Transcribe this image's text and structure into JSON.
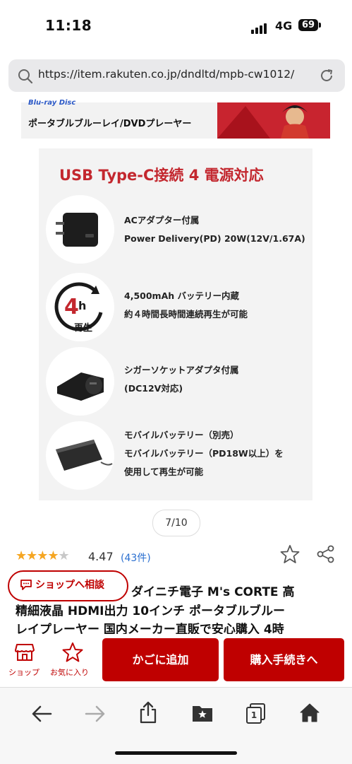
{
  "status_bar": {
    "time": "11:18",
    "network": "4G",
    "battery": "69"
  },
  "browser": {
    "url": "https://item.rakuten.co.jp/dndltd/mpb-cw1012/"
  },
  "banner": {
    "brand": "Blu-ray Disc",
    "text": "ポータブルブルーレイ/DVDプレーヤー"
  },
  "product_image": {
    "heading": "USB Type-C接続 4 電源対応",
    "features": [
      {
        "lines": [
          "ACアダプター付属",
          "Power Delivery(PD) 20W(12V/1.67A)"
        ]
      },
      {
        "icon_text": "4h",
        "icon_label": "再生",
        "lines": [
          "4,500mAh バッテリー内蔵",
          "約４時間長時間連続再生が可能"
        ]
      },
      {
        "lines": [
          "シガーソケットアダプタ付属",
          "(DC12V対応)"
        ]
      },
      {
        "lines": [
          "モバイルバッテリー（別売）",
          "モバイルバッテリー（PD18W以上）を",
          "使用して再生が可能"
        ]
      }
    ]
  },
  "pager": "7/10",
  "rating": {
    "value": "4.47",
    "count": "(43件)",
    "stars": 4.47
  },
  "consult_button": "ショップへ相談",
  "product_title": {
    "line1": "ダイニチ電子 M's CORTE 高",
    "line2": "精細液晶 HDMI出力 10インチ ポータブルブルー",
    "line3": "レイプレーヤー 国内メーカー直販で安心購入 4時"
  },
  "action_bar": {
    "shop_label": "ショップ",
    "favorite_label": "お気に入り",
    "cart_button": "かごに追加",
    "buy_button": "購入手続きへ"
  },
  "toolbar": {
    "tabs_count": "1"
  },
  "colors": {
    "rakuten_red": "#bf0000",
    "heading_red": "#c3272e",
    "star": "#f5a623",
    "link_blue": "#2a6fd0"
  }
}
